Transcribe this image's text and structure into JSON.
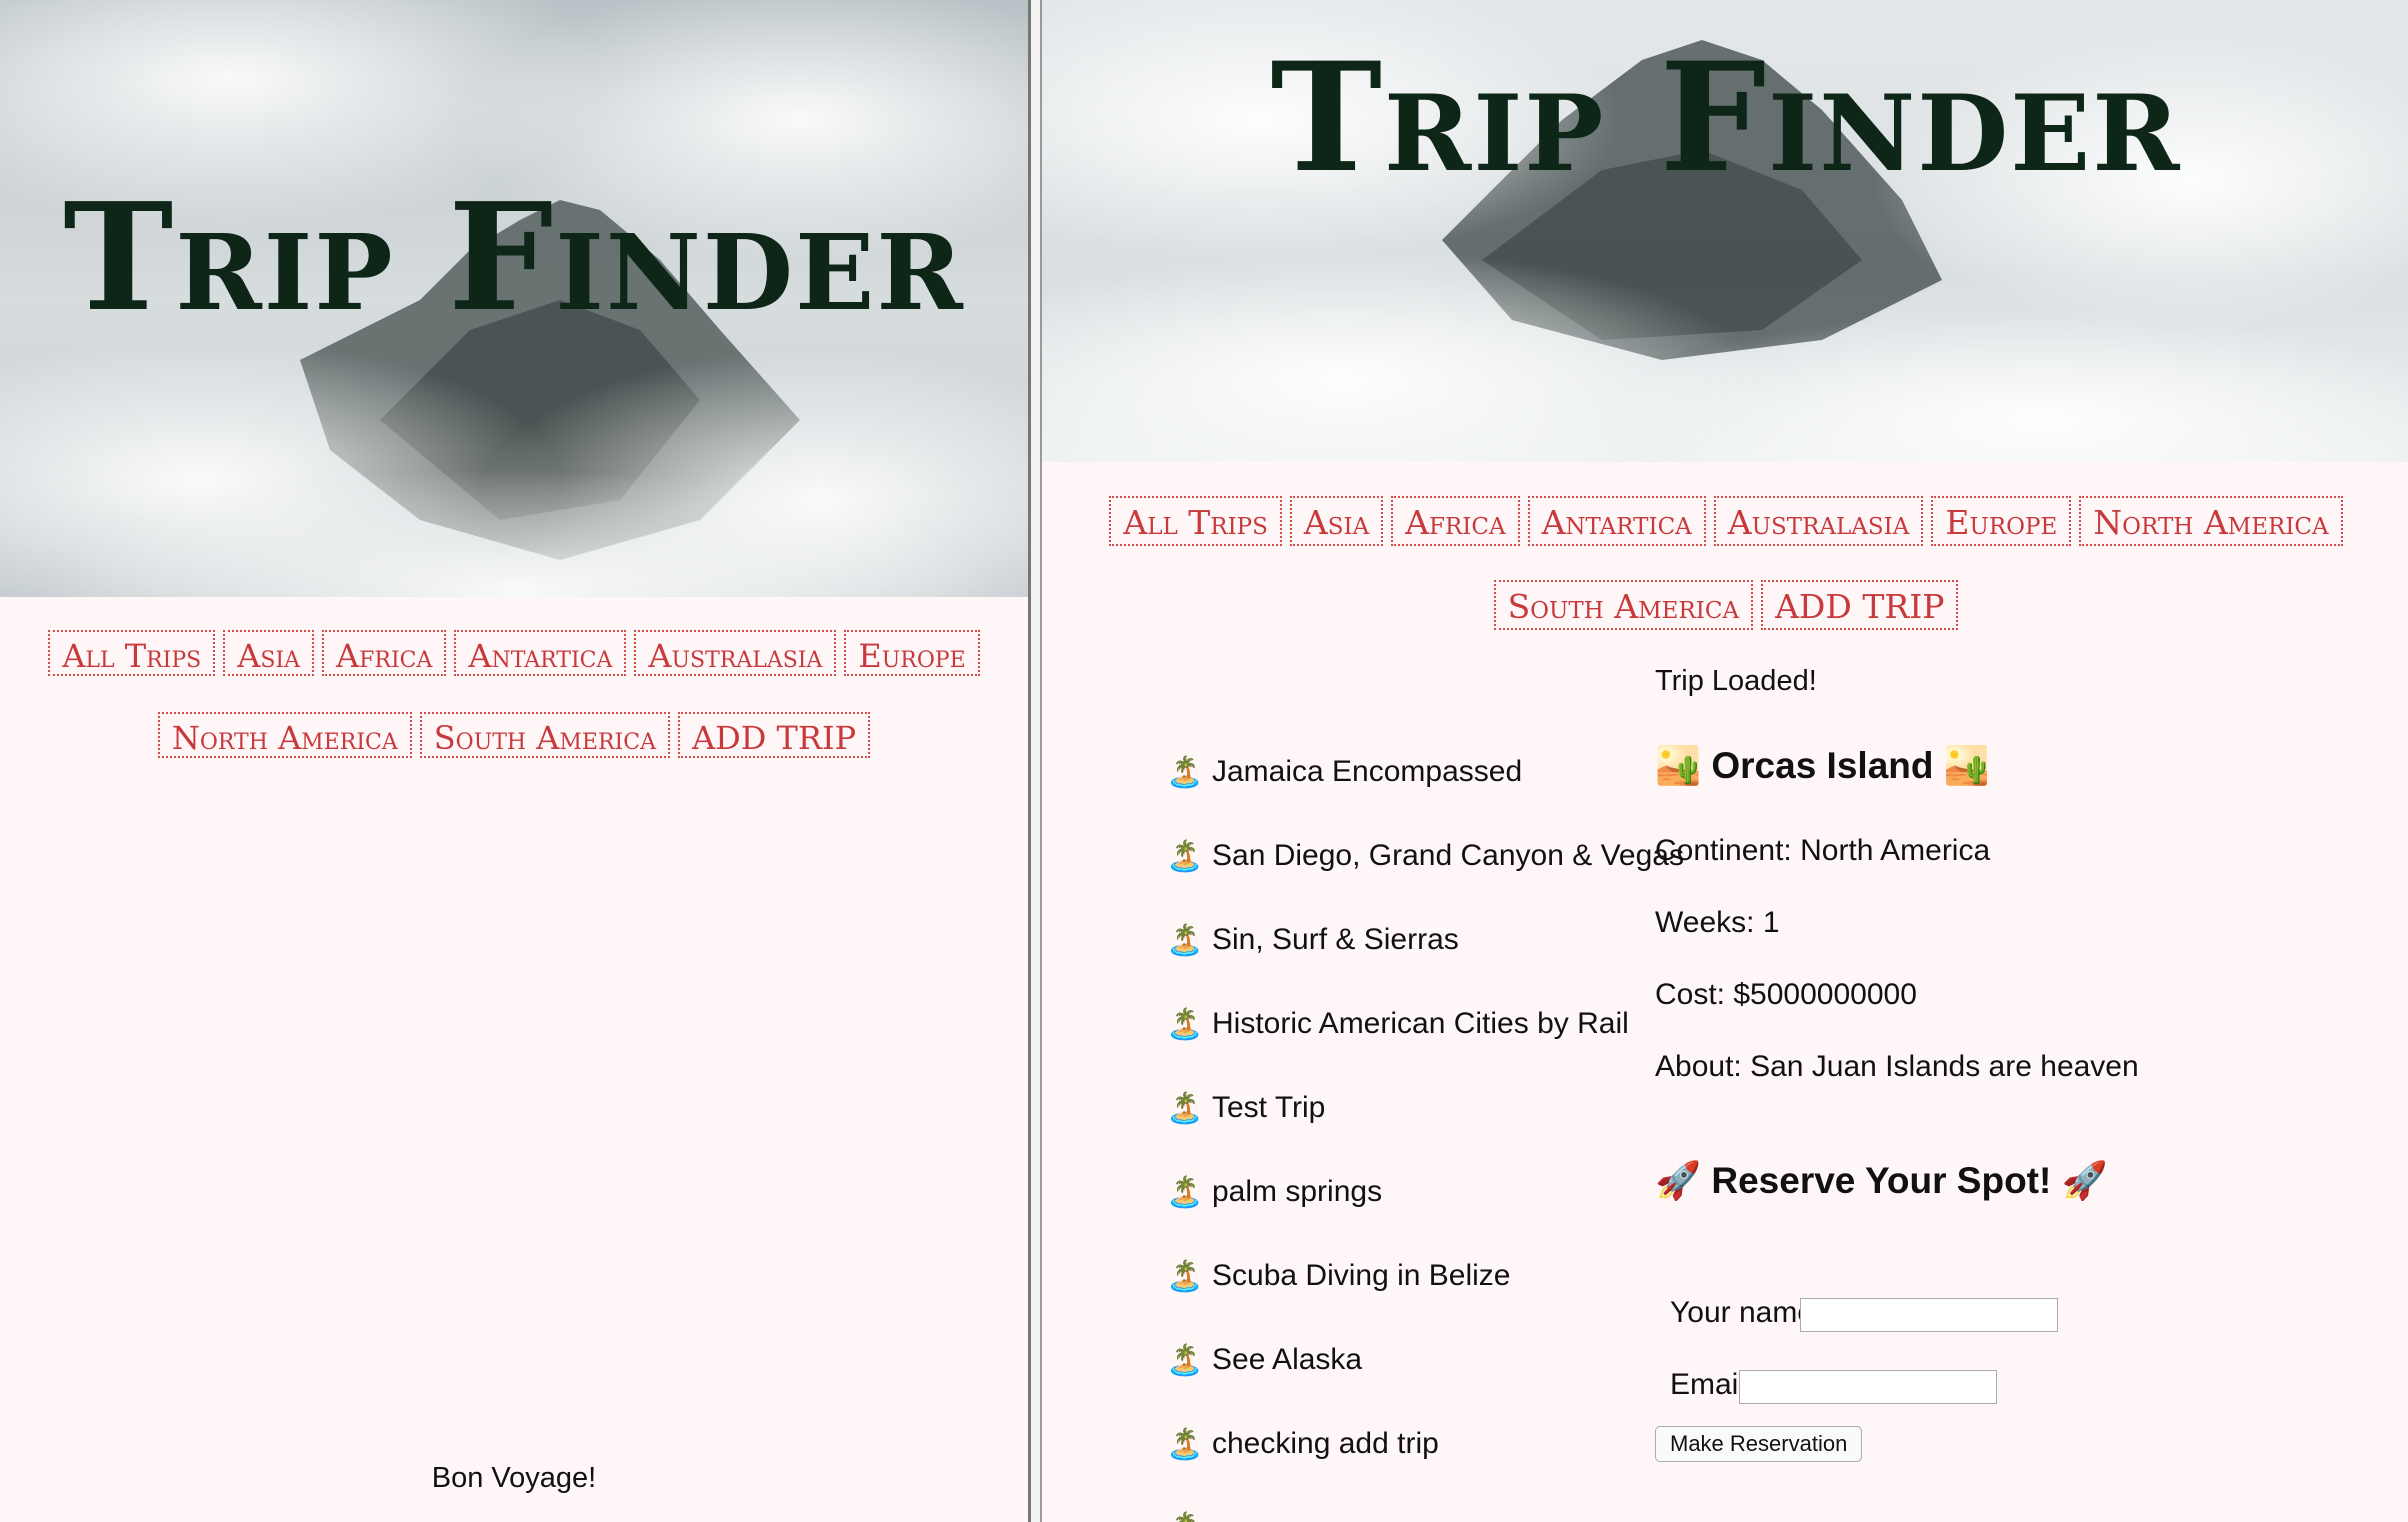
{
  "app": {
    "title": "Trip Finder",
    "footer": "Bon Voyage!"
  },
  "nav": {
    "left_rows": [
      [
        "All Trips",
        "Asia",
        "Africa",
        "Antartica",
        "Australasia",
        "Europe"
      ],
      [
        "North America",
        "South America",
        "ADD TRIP"
      ]
    ],
    "right_rows": [
      [
        "All Trips",
        "Asia",
        "Africa",
        "Antartica",
        "Australasia",
        "Europe",
        "North America"
      ],
      [
        "South America",
        "ADD TRIP"
      ]
    ]
  },
  "status": "Trip Loaded!",
  "trips": [
    "Jamaica Encompassed",
    "San Diego, Grand Canyon & Vegas",
    "Sin, Surf & Sierras",
    "Historic American Cities by Rail",
    "Test Trip",
    "palm springs",
    "Scuba Diving in Belize",
    "See Alaska",
    "checking add trip"
  ],
  "trip_icon": "🏝️",
  "detail": {
    "title": "Orcas Island",
    "title_icon": "🏜️",
    "continent": "Continent: North America",
    "weeks": "Weeks: 1",
    "cost": "Cost: $5000000000",
    "about": "About: San Juan Islands are heaven"
  },
  "reserve": {
    "title": "Reserve Your Spot!",
    "icon": "🚀",
    "name_label": "Your name:",
    "email_label": "Email",
    "name_value": "",
    "email_value": "",
    "button": "Make Reservation"
  },
  "colors": {
    "accent": "#c8393c",
    "title": "#0e2618",
    "background": "#fff6f8"
  }
}
